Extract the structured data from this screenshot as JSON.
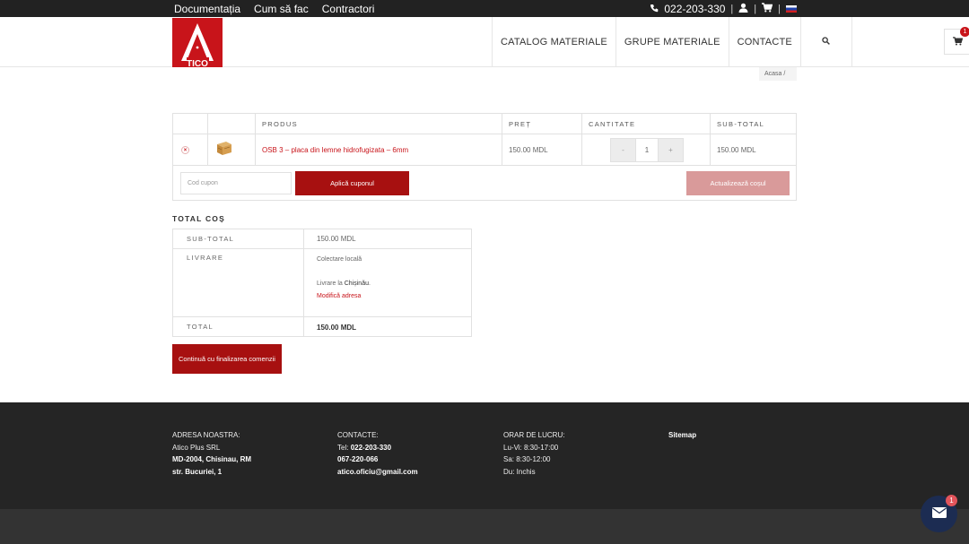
{
  "topbar": {
    "links": [
      "Documentația",
      "Cum să fac",
      "Contractori"
    ],
    "phone": "022-203-330",
    "separator": "|",
    "icons": [
      "phone-icon",
      "user-icon",
      "cart-icon",
      "flag-ru-icon"
    ]
  },
  "header": {
    "logo_text": "TICO",
    "nav": [
      "CATALOG MATERIALE",
      "GRUPE MATERIALE",
      "CONTACTE"
    ],
    "cart_count": "1"
  },
  "breadcrumb": {
    "home": "Acasa",
    "sep": "/"
  },
  "cart": {
    "headers": {
      "product": "PRODUS",
      "price": "PREȚ",
      "quantity": "CANTITATE",
      "subtotal": "SUB-TOTAL"
    },
    "item": {
      "remove": "×",
      "name": "OSB 3 – placa din lemne hidrofugizata – 6mm",
      "price": "150.00 MDL",
      "qty_minus": "-",
      "qty": "1",
      "qty_plus": "+",
      "subtotal": "150.00 MDL"
    },
    "coupon_placeholder": "Cod cupon",
    "apply_label": "Aplică cuponul",
    "update_label": "Actualizează coșul"
  },
  "totals": {
    "title": "TOTAL COȘ",
    "subtotal_label": "SUB-TOTAL",
    "subtotal_value": "150.00 MDL",
    "shipping_label": "LIVRARE",
    "shipping_method": "Colectare locală",
    "shipping_to_prefix": "Livrare la",
    "shipping_city": "Chișinău",
    "shipping_suffix": ".",
    "change_address": "Modifică adresa",
    "total_label": "TOTAL",
    "total_value": "150.00 MDL",
    "checkout_label": "Continuă cu finalizarea comenzii"
  },
  "footer": {
    "address": {
      "title": "ADRESA NOASTRA:",
      "line1": "Atico Plus SRL",
      "line2": "MD-2004, Chisinau, RM",
      "line3": "str. Bucuriei, 1"
    },
    "contacts": {
      "title": "CONTACTE:",
      "tel_prefix": "Tel:",
      "tel1": "022-203-330",
      "tel2": "067-220-066",
      "email": "atico.oficiu@gmail.com"
    },
    "hours": {
      "title": "ORAR DE LUCRU:",
      "line1": "Lu-Vi: 8:30-17:00",
      "line2": "Sa: 8:30-12:00",
      "line3": "Du: Inchis"
    },
    "sitemap": "Sitemap"
  },
  "chat_badge": "1",
  "colors": {
    "brand_red": "#c8141a",
    "button_red": "#a71010",
    "footer_dark": "#252525",
    "chat_navy": "#1c2c52"
  }
}
